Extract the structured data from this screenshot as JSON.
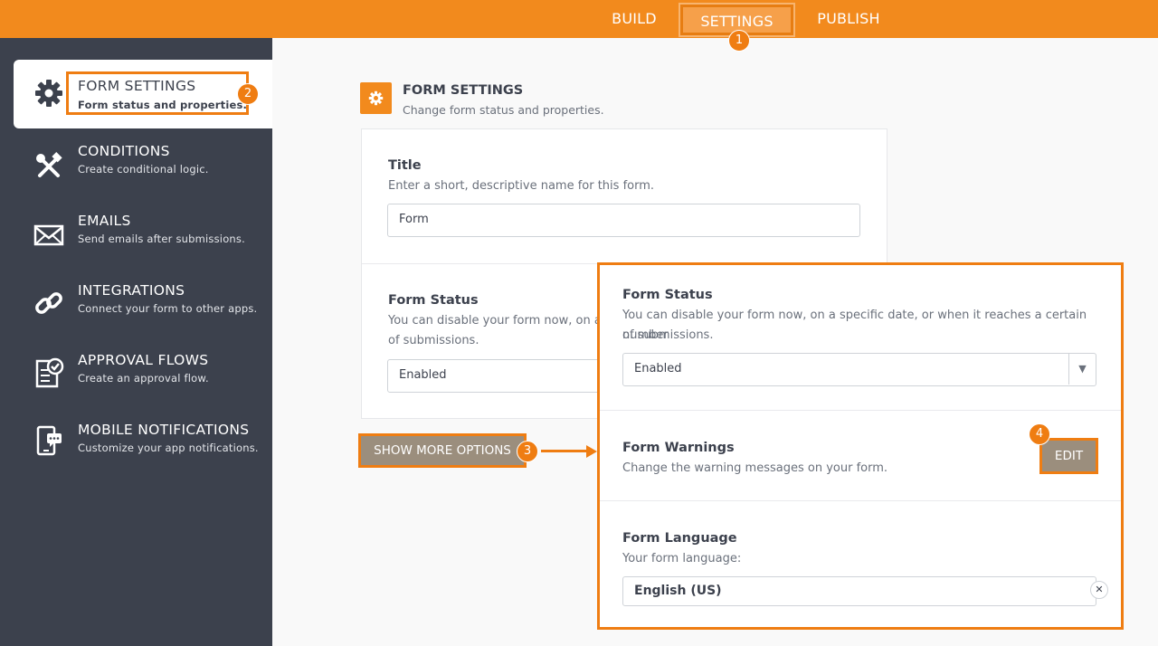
{
  "topnav": {
    "build": "BUILD",
    "settings": "SETTINGS",
    "publish": "PUBLISH"
  },
  "markers": {
    "m1": "1",
    "m2": "2",
    "m3": "3",
    "m4": "4"
  },
  "sidebar": {
    "items": [
      {
        "title": "FORM SETTINGS",
        "desc": "Form status and properties.",
        "icon": "gear-icon"
      },
      {
        "title": "CONDITIONS",
        "desc": "Create conditional logic.",
        "icon": "tools-icon"
      },
      {
        "title": "EMAILS",
        "desc": "Send emails after submissions.",
        "icon": "envelope-icon"
      },
      {
        "title": "INTEGRATIONS",
        "desc": "Connect your form to other apps.",
        "icon": "link-icon"
      },
      {
        "title": "APPROVAL FLOWS",
        "desc": "Create an approval flow.",
        "icon": "approval-icon"
      },
      {
        "title": "MOBILE NOTIFICATIONS",
        "desc": "Customize your app notifications.",
        "icon": "mobile-icon"
      }
    ]
  },
  "section": {
    "title": "FORM SETTINGS",
    "subtitle": "Change form status and properties."
  },
  "title_field": {
    "label": "Title",
    "hint": "Enter a short, descriptive name for this form.",
    "value": "Form"
  },
  "status_field": {
    "label": "Form Status",
    "hint_line1": "You can disable your form now, on a sp",
    "hint_line2": "of submissions.",
    "value": "Enabled"
  },
  "show_more": "SHOW MORE OPTIONS",
  "zoom": {
    "status_label": "Form Status",
    "status_hint_line1": "You can disable your form now, on a specific date, or when it reaches a certain number",
    "status_hint_line2": "of submissions.",
    "status_value": "Enabled",
    "warnings_label": "Form Warnings",
    "warnings_hint": "Change the warning messages on your form.",
    "edit": "EDIT",
    "language_label": "Form Language",
    "language_hint": "Your form language:",
    "language_value": "English (US)"
  },
  "colors": {
    "accent": "#f28a1d",
    "sidebar": "#3c414d",
    "button": "#9b8e7d"
  }
}
